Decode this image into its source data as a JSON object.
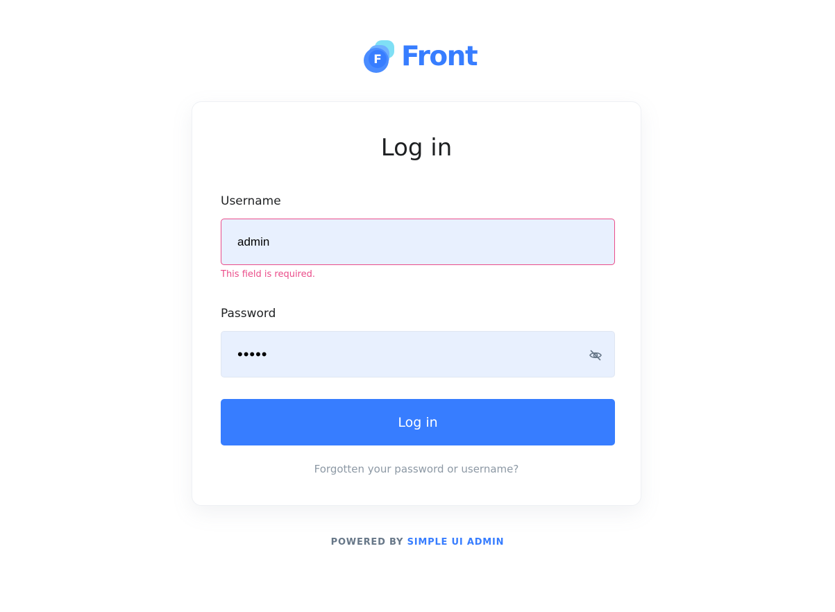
{
  "brand": {
    "name": "Front",
    "letter": "F",
    "color": "#377dff"
  },
  "form": {
    "title": "Log in",
    "username": {
      "label": "Username",
      "value": "admin",
      "error": "This field is required."
    },
    "password": {
      "label": "Password",
      "masked_value": "•••••",
      "toggle_icon": "eye-off-icon"
    },
    "submit_label": "Log in",
    "forgot_link": "Forgotten your password or username?"
  },
  "footer": {
    "prefix": "POWERED BY",
    "link": "SIMPLE UI ADMIN"
  },
  "colors": {
    "primary": "#377dff",
    "error": "#ea4c89",
    "input_bg": "#e8f0fe",
    "muted": "#8c98a4"
  }
}
